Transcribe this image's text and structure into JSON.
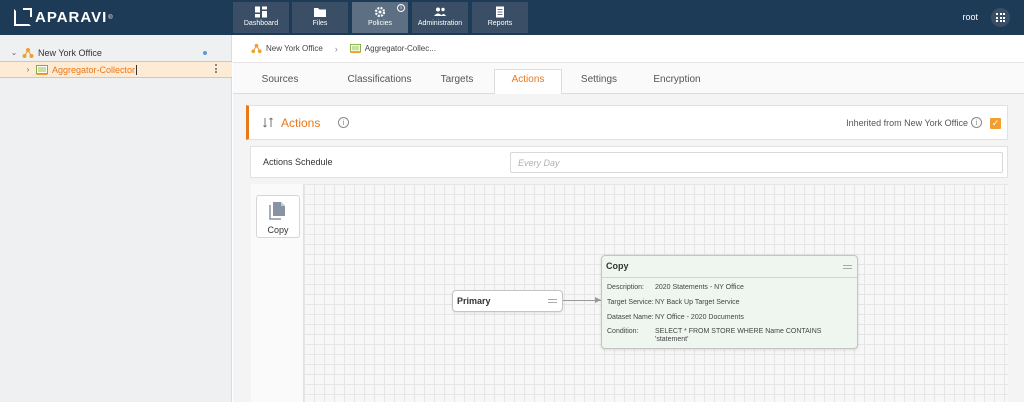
{
  "brand": {
    "name": "APARAVI",
    "reg": "®"
  },
  "nav": {
    "items": [
      {
        "label": "Dashboard",
        "icon": "dashboard-icon"
      },
      {
        "label": "Files",
        "icon": "folder-icon"
      },
      {
        "label": "Policies",
        "icon": "gear-icon",
        "active": true
      },
      {
        "label": "Administration",
        "icon": "users-icon"
      },
      {
        "label": "Reports",
        "icon": "report-icon"
      }
    ],
    "user": "root"
  },
  "tree": {
    "root_label": "New York Office",
    "child_label": "Aggregator-Collector"
  },
  "breadcrumb": {
    "item1": "New York Office",
    "item2": "Aggregator-Collec..."
  },
  "tabs": [
    "Sources",
    "Classifications",
    "Targets",
    "Actions",
    "Settings",
    "Encryption"
  ],
  "actions": {
    "title": "Actions",
    "inherited_label": "Inherited from New York Office",
    "inherited_checked": true,
    "schedule_label": "Actions Schedule",
    "schedule_placeholder": "Every Day"
  },
  "palette": {
    "copy_label": "Copy"
  },
  "flow": {
    "primary_label": "Primary",
    "copy_node": {
      "title": "Copy",
      "rows": [
        {
          "key": "Description:",
          "value": "2020 Statements - NY Office"
        },
        {
          "key": "Target Service:",
          "value": "NY Back Up Target Service"
        },
        {
          "key": "Dataset Name:",
          "value": "NY Office - 2020 Documents"
        },
        {
          "key": "Condition:",
          "value": "SELECT * FROM STORE WHERE Name CONTAINS 'statement'"
        }
      ]
    }
  },
  "colors": {
    "accent": "#e9781a",
    "nav_bg": "#1d3a57",
    "node_bg": "#eff6f0"
  }
}
